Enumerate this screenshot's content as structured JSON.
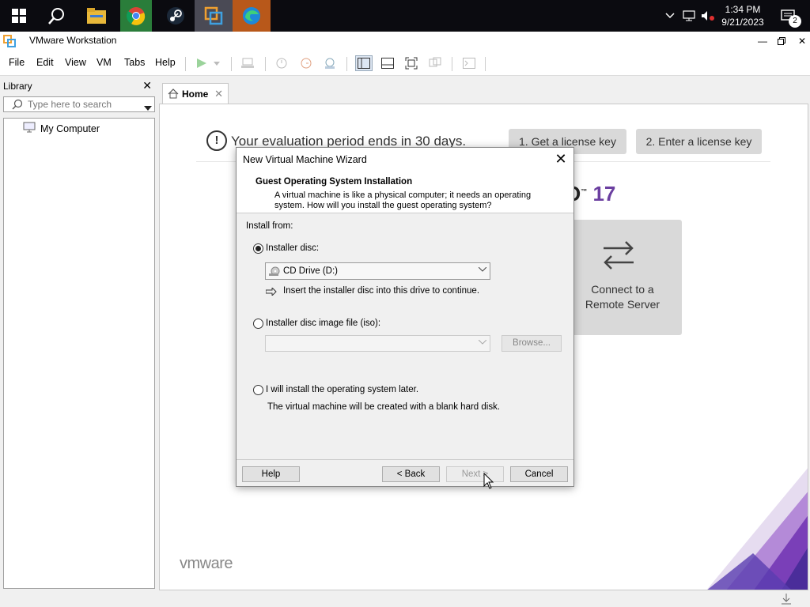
{
  "taskbar": {
    "apps": [
      {
        "name": "start",
        "icon": "windows-start-icon"
      },
      {
        "name": "search",
        "icon": "search-icon"
      },
      {
        "name": "file-explorer",
        "icon": "folder-icon"
      },
      {
        "name": "chrome",
        "icon": "chrome-icon"
      },
      {
        "name": "steam",
        "icon": "steam-icon"
      },
      {
        "name": "vmware",
        "icon": "vmware-icon"
      },
      {
        "name": "edge",
        "icon": "edge-icon"
      }
    ],
    "time": "1:34 PM",
    "date": "9/21/2023",
    "notification_count": "2"
  },
  "window": {
    "title": "VMware Workstation"
  },
  "menu": {
    "file": "File",
    "edit": "Edit",
    "view": "View",
    "vm": "VM",
    "tabs": "Tabs",
    "help": "Help"
  },
  "library": {
    "title": "Library",
    "search_placeholder": "Type here to search",
    "tree": [
      {
        "label": "My Computer"
      }
    ]
  },
  "tabs": [
    {
      "label": "Home",
      "active": true
    }
  ],
  "home": {
    "evaluation_text": "Your evaluation period ends in 30 days.",
    "license_buttons": [
      "1. Get a license key",
      "2. Enter a license key"
    ],
    "product_version": "17",
    "remote_card": {
      "line1": "Connect to a",
      "line2": "Remote Server"
    },
    "brand": "vmware"
  },
  "dialog": {
    "title": "New Virtual Machine Wizard",
    "heading": "Guest Operating System Installation",
    "subtitle": "A virtual machine is like a physical computer; it needs an operating system. How will you install the guest operating system?",
    "install_from_label": "Install from:",
    "option_disc": {
      "label": "Installer disc:",
      "selected": true,
      "drive_value": "CD Drive (D:)",
      "hint": "Insert the installer disc into this drive to continue."
    },
    "option_iso": {
      "label": "Installer disc image file (iso):",
      "selected": false,
      "value": "",
      "browse_label": "Browse..."
    },
    "option_later": {
      "label": "I will install the operating system later.",
      "selected": false,
      "hint": "The virtual machine will be created with a blank hard disk."
    },
    "buttons": {
      "help": "Help",
      "back": "< Back",
      "next": "Next >",
      "cancel": "Cancel"
    }
  },
  "colors": {
    "taskbar_bg": "#0b0b10",
    "accent_purple": "#6b3fa0",
    "license_button_bg": "#d9d9d9"
  }
}
